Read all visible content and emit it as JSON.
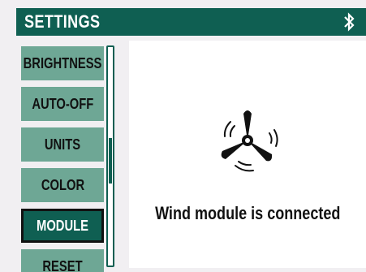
{
  "header": {
    "title": "SETTINGS",
    "icon": "bluetooth-icon"
  },
  "menu": {
    "items": [
      {
        "label": "BRIGHTNESS",
        "active": false
      },
      {
        "label": "AUTO-OFF",
        "active": false
      },
      {
        "label": "UNITS",
        "active": false
      },
      {
        "label": "COLOR",
        "active": false
      },
      {
        "label": "MODULE",
        "active": true
      },
      {
        "label": "RESET",
        "active": false
      }
    ]
  },
  "panel": {
    "icon": "wind-fan-icon",
    "status_text": "Wind module is connected"
  },
  "colors": {
    "accent": "#0f5f52",
    "menu_item": "#6ea795",
    "background": "#f1eff2"
  }
}
